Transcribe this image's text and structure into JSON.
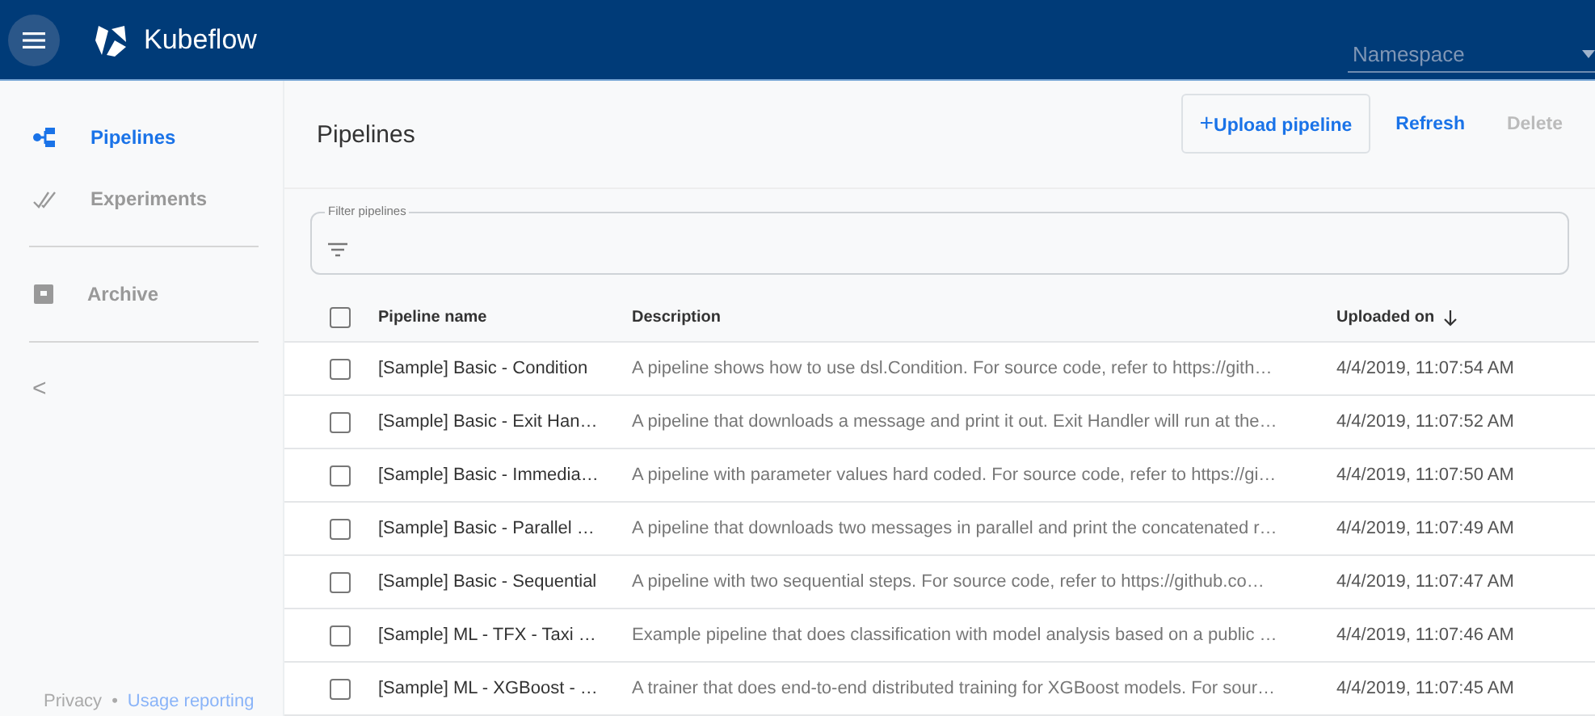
{
  "header": {
    "title": "Kubeflow",
    "namespace": {
      "placeholder": "Namespace"
    }
  },
  "sidebar": {
    "items": [
      {
        "label": "Pipelines",
        "kind": "pipelines",
        "selected": true
      },
      {
        "label": "Experiments",
        "kind": "experiments",
        "selected": false
      },
      {
        "label": "Archive",
        "kind": "archive",
        "selected": false
      }
    ],
    "collapse": "<",
    "footer": {
      "privacy": "Privacy",
      "separator": "•",
      "usage": "Usage reporting"
    }
  },
  "page": {
    "title": "Pipelines",
    "actions": [
      {
        "label": "Upload pipeline",
        "icon": "+",
        "kind": "outlined",
        "disabled": false
      },
      {
        "label": "Refresh",
        "kind": "text",
        "disabled": false
      },
      {
        "label": "Delete",
        "kind": "text",
        "disabled": true
      }
    ]
  },
  "filter": {
    "label": "Filter pipelines"
  },
  "table": {
    "all_checked": false,
    "columns": [
      {
        "label": "Pipeline name",
        "sorted": false
      },
      {
        "label": "Description",
        "sorted": false
      },
      {
        "label": "Uploaded on",
        "sorted": true
      }
    ],
    "rows": [
      {
        "checked": false,
        "cells": [
          "[Sample] Basic - Condition",
          "A pipeline shows how to use dsl.Condition. For source code, refer to https://gith…",
          "4/4/2019, 11:07:54 AM"
        ]
      },
      {
        "checked": false,
        "cells": [
          "[Sample] Basic - Exit Han…",
          "A pipeline that downloads a message and print it out. Exit Handler will run at the…",
          "4/4/2019, 11:07:52 AM"
        ]
      },
      {
        "checked": false,
        "cells": [
          "[Sample] Basic - Immedia…",
          "A pipeline with parameter values hard coded. For source code, refer to https://gi…",
          "4/4/2019, 11:07:50 AM"
        ]
      },
      {
        "checked": false,
        "cells": [
          "[Sample] Basic - Parallel …",
          "A pipeline that downloads two messages in parallel and print the concatenated r…",
          "4/4/2019, 11:07:49 AM"
        ]
      },
      {
        "checked": false,
        "cells": [
          "[Sample] Basic - Sequential",
          "A pipeline with two sequential steps. For source code, refer to https://github.co…",
          "4/4/2019, 11:07:47 AM"
        ]
      },
      {
        "checked": false,
        "cells": [
          "[Sample] ML - TFX - Taxi …",
          "Example pipeline that does classification with model analysis based on a public …",
          "4/4/2019, 11:07:46 AM"
        ]
      },
      {
        "checked": false,
        "cells": [
          "[Sample] ML - XGBoost - …",
          "A trainer that does end-to-end distributed training for XGBoost models. For sour…",
          "4/4/2019, 11:07:45 AM"
        ]
      }
    ]
  }
}
